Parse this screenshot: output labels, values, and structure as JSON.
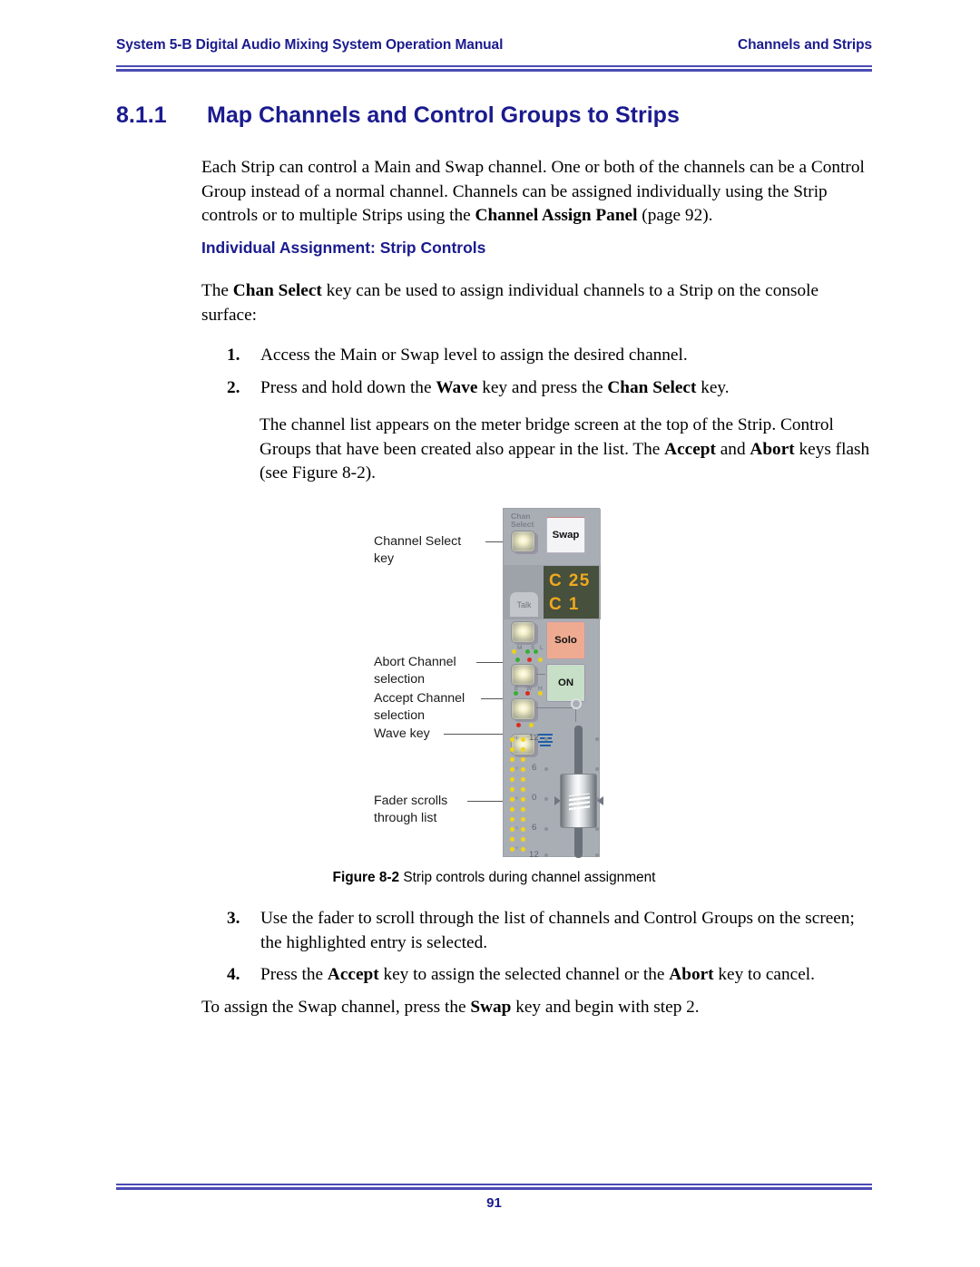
{
  "running_head": {
    "left": "System 5-B Digital Audio Mixing System Operation Manual",
    "right": "Channels and Strips",
    "color": "#1b1b8f"
  },
  "heading": {
    "number": "8.1.1",
    "title": "Map Channels and Control Groups to Strips"
  },
  "intro_paragraph": "Each Strip can control a Main and Swap channel. One or both of the channels can be a Control Group instead of a normal channel. Channels can be assigned individually using the Strip controls or to multiple Strips using the ",
  "intro_paragraph_bold": "Channel Assign Panel",
  "intro_paragraph_tail": " (page 92).",
  "subheading": "Individual Assignment: Strip Controls",
  "chansel_paragraph": {
    "lead": "The ",
    "bold": "Chan Select",
    "tail": " key can be used to assign individual channels to a Strip on the console surface:"
  },
  "steps": [
    {
      "number": "1.",
      "segments": [
        {
          "text": "Access the Main or Swap level to assign the desired channel.",
          "bold": false
        }
      ]
    },
    {
      "number": "2.",
      "segments": [
        {
          "text": "Press and hold down the ",
          "bold": false
        },
        {
          "text": "Wave",
          "bold": true
        },
        {
          "text": " key and press the ",
          "bold": false
        },
        {
          "text": "Chan Select",
          "bold": true
        },
        {
          "text": " key.",
          "bold": false
        }
      ]
    },
    {
      "number": "3.",
      "segments": [
        {
          "text": "Use the fader to scroll through the list of channels and Control Groups on the screen; the highlighted entry is selected.",
          "bold": false
        }
      ]
    },
    {
      "number": "4.",
      "segments": [
        {
          "text": "Press the ",
          "bold": false
        },
        {
          "text": "Accept",
          "bold": true
        },
        {
          "text": " key to assign the selected channel or the ",
          "bold": false
        },
        {
          "text": "Abort",
          "bold": true
        },
        {
          "text": " key to cancel.",
          "bold": false
        }
      ]
    }
  ],
  "list_paragraph": {
    "seg1": "The channel list appears on the meter bridge screen at the top of the Strip. Control Groups that have been created also appear in the list. The ",
    "bold1": "Accept",
    "seg2": " and ",
    "bold2": "Abort",
    "seg3": " keys flash (see Figure 8-2)."
  },
  "swap_note": {
    "seg1": "To assign the Swap channel, press the ",
    "bold1": "Swap",
    "seg2": " key and begin with step 2."
  },
  "figure": {
    "caption_bold": "Figure 8-2",
    "caption_text": " Strip controls during channel assignment",
    "callouts": [
      {
        "line1": "Channel Select",
        "line2": "key"
      },
      {
        "line1": "Abort  Channel",
        "line2": "selection"
      },
      {
        "line1": "Accept  Channel",
        "line2": "selection"
      },
      {
        "line1": "Wave  key",
        "line2": ""
      },
      {
        "line1": "Fader scrolls",
        "line2": "through  list"
      }
    ],
    "strip": {
      "chan_select_label_l1": "Chan",
      "chan_select_label_l2": "Select",
      "swap_button": "Swap",
      "solo_button": "Solo",
      "on_button": "ON",
      "talk_tab": "Talk",
      "display_line1": "C 25",
      "display_line2": "C 1",
      "display_bg": "#474f3d",
      "display_fg": "#f0a91e",
      "led_labels_upper": [
        "M",
        "S",
        "L"
      ],
      "led_labels_lower": [
        "E",
        "W",
        "H"
      ],
      "meter_ticks": [
        "12",
        "6",
        "0",
        "6",
        "12"
      ],
      "body_color": "#a9aeb5",
      "solo_color": "#eeab92",
      "on_color": "#c6dfc6"
    }
  },
  "folio": "91"
}
